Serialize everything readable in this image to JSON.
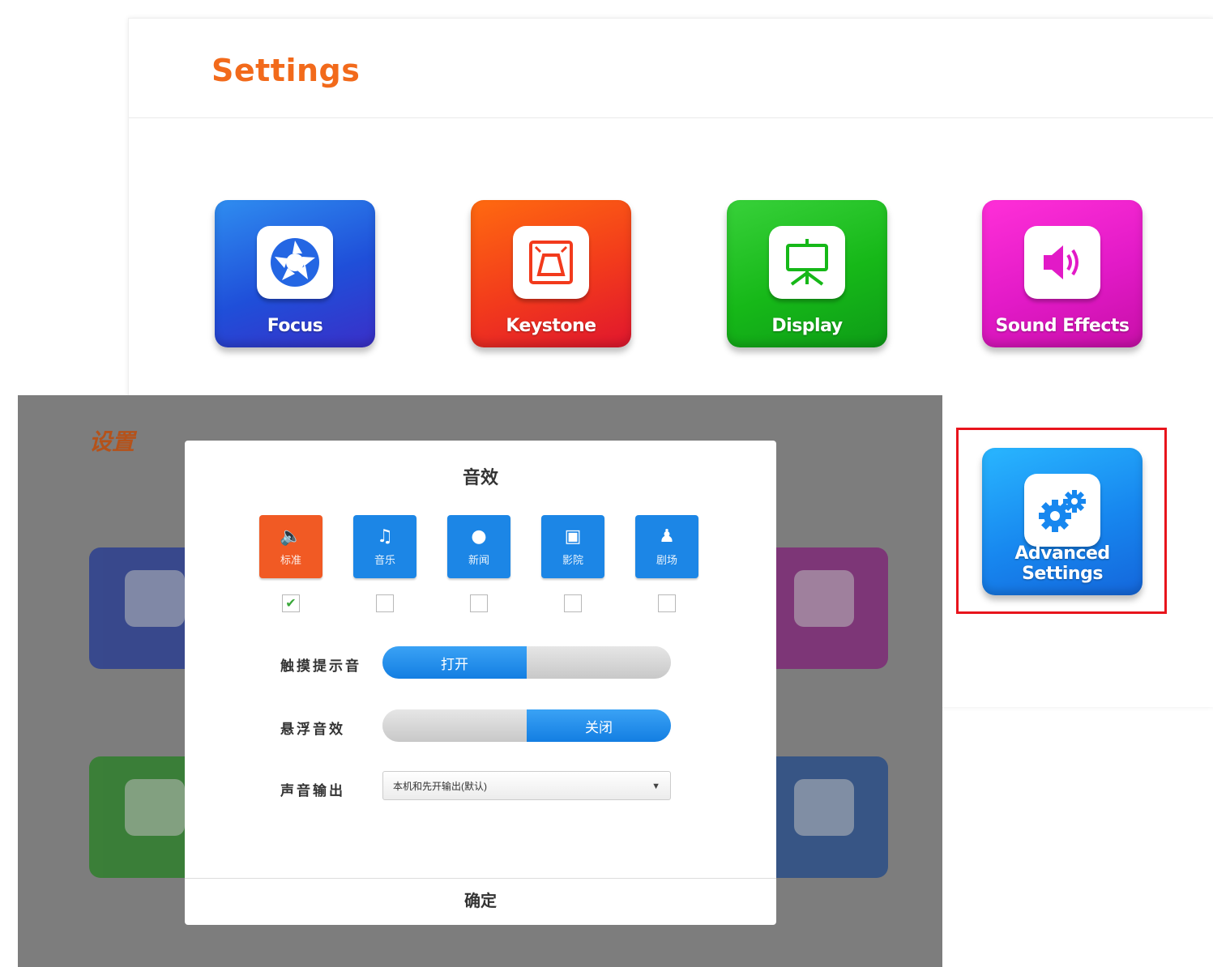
{
  "settings": {
    "title": "Settings",
    "tiles": [
      {
        "label": "Focus",
        "icon": "aperture-icon"
      },
      {
        "label": "Keystone",
        "icon": "keystone-icon"
      },
      {
        "label": "Display",
        "icon": "projector-screen-icon"
      },
      {
        "label": "Sound Effects",
        "icon": "speaker-icon"
      },
      {
        "label": "Advanced Settings",
        "icon": "gears-icon"
      }
    ],
    "highlight_color": "#e8141c",
    "title_color": "#f26a1b"
  },
  "overlay": {
    "bg_title": "设置"
  },
  "dialog": {
    "title": "音效",
    "modes": [
      {
        "label": "标准",
        "icon": "speaker-icon",
        "active": true,
        "checked": true
      },
      {
        "label": "音乐",
        "icon": "music-note-icon",
        "active": false,
        "checked": false
      },
      {
        "label": "新闻",
        "icon": "microphone-icon",
        "active": false,
        "checked": false
      },
      {
        "label": "影院",
        "icon": "loudspeaker-icon",
        "active": false,
        "checked": false
      },
      {
        "label": "剧场",
        "icon": "person-icon",
        "active": false,
        "checked": false
      }
    ],
    "touch_sound": {
      "label": "触摸提示音",
      "on_label": "打开",
      "off_label": "",
      "value": "on"
    },
    "float_sound": {
      "label": "悬浮音效",
      "on_label": "关闭",
      "off_label": "",
      "value": "off"
    },
    "audio_output": {
      "label": "声音输出",
      "value": "本机和先开输出(默认)"
    },
    "confirm_label": "确定"
  }
}
